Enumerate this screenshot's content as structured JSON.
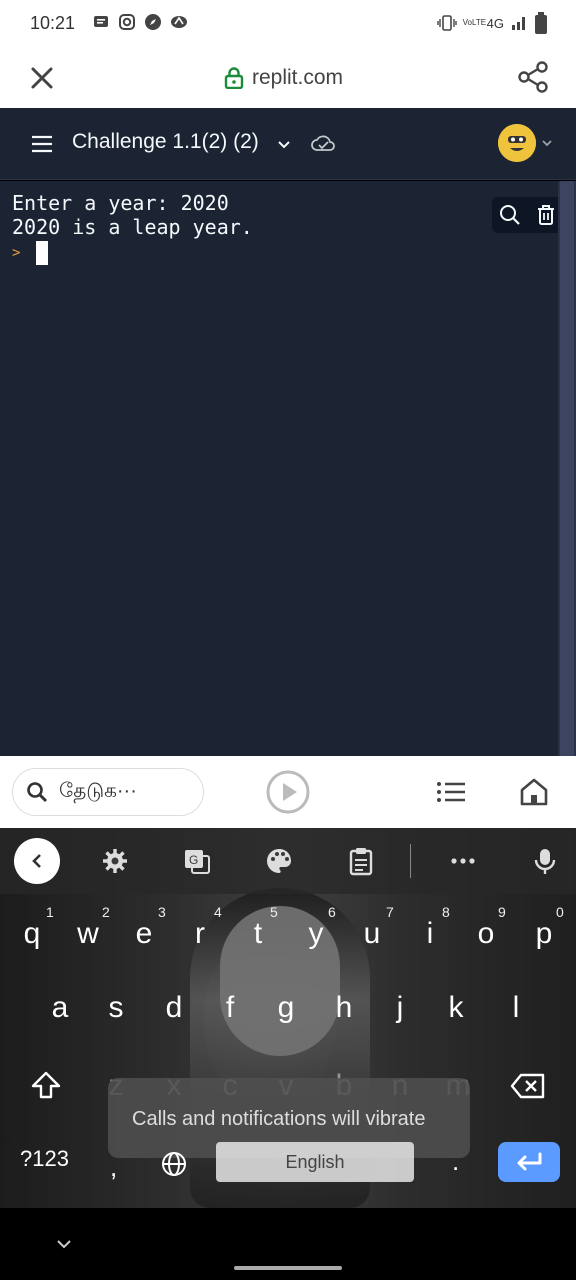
{
  "status_bar": {
    "time": "10:21",
    "network": "4G",
    "volte": "VoLTE"
  },
  "browser": {
    "url": "replit.com"
  },
  "replit": {
    "title": "Challenge 1.1(2) (2)"
  },
  "console": {
    "lines": [
      "Enter a year: 2020",
      "2020 is a leap year."
    ],
    "prompt": ">"
  },
  "bottom_bar": {
    "search_placeholder": "தேடுக···"
  },
  "keyboard": {
    "row1": [
      "q",
      "w",
      "e",
      "r",
      "t",
      "y",
      "u",
      "i",
      "o",
      "p"
    ],
    "row1_hints": [
      "1",
      "2",
      "3",
      "4",
      "5",
      "6",
      "7",
      "8",
      "9",
      "0"
    ],
    "row2": [
      "a",
      "s",
      "d",
      "f",
      "g",
      "h",
      "j",
      "k",
      "l"
    ],
    "row3": [
      "z",
      "x",
      "c",
      "v",
      "b",
      "n",
      "m"
    ],
    "symbols_key": "?123",
    "comma": ",",
    "space_label": "English",
    "period": ".",
    "toast": "Calls and notifications will vibrate"
  },
  "colors": {
    "replit_bg": "#1c2333",
    "enter_key": "#5b9bff",
    "lock_green": "#1a8d3a",
    "avatar": "#f0c33c"
  }
}
